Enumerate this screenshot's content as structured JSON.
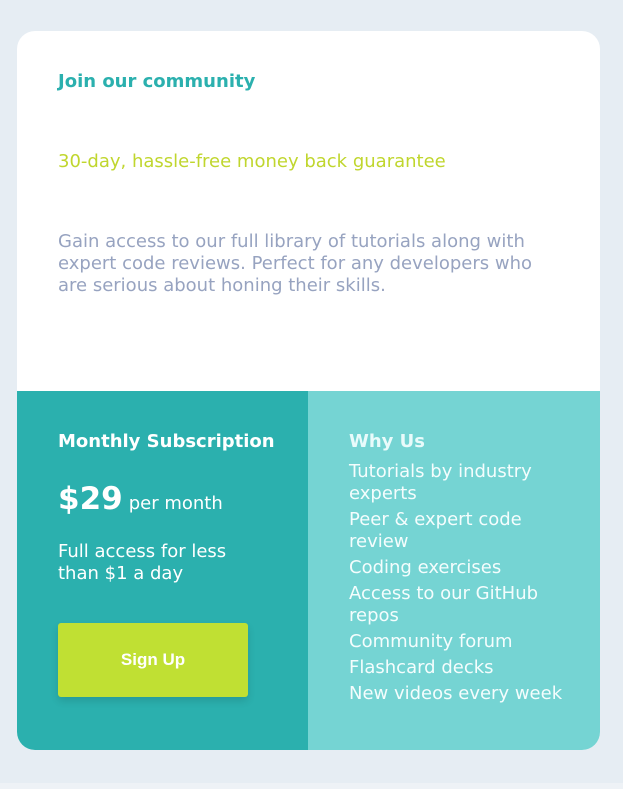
{
  "header": {
    "title": "Join our community",
    "tagline": "30-day, hassle-free money back guarantee",
    "description": "Gain access to our full library of tutorials along with expert code reviews. Perfect for any developers who are serious about honing their skills."
  },
  "subscription": {
    "title": "Monthly Subscription",
    "price": "$29",
    "period": "per month",
    "access": "Full access for less than $1 a day",
    "button_label": "Sign Up"
  },
  "why": {
    "title": "Why Us",
    "items": [
      "Tutorials by industry experts",
      "Peer & expert code review",
      "Coding exercises",
      "Access to our GitHub repos",
      "Community forum",
      "Flashcard decks",
      "New videos every week"
    ]
  },
  "colors": {
    "page_background": "#e6edf3",
    "card_background": "#ffffff",
    "title": "#2bb0ae",
    "tagline": "#c0d62e",
    "description": "#97a3c0",
    "subscription_panel": "#2bb0ae",
    "why_panel": "#75d4d3",
    "button": "#c0e033"
  }
}
